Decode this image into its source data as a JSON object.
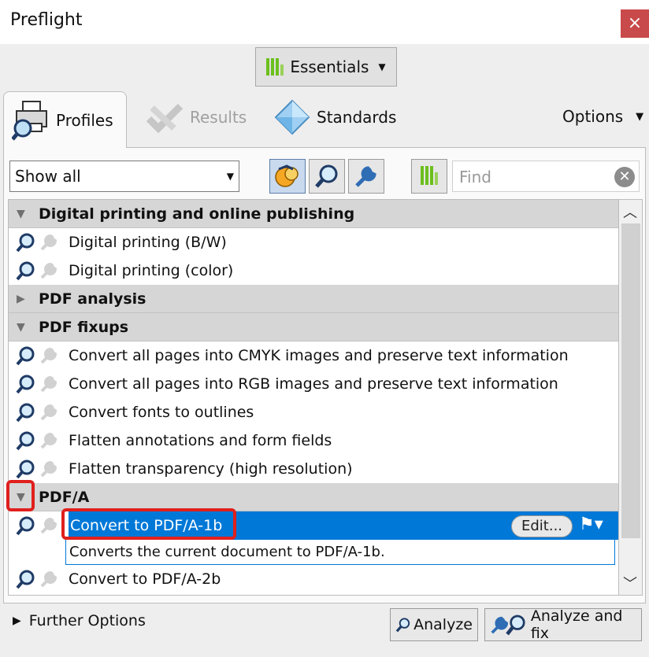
{
  "window": {
    "title": "Preflight",
    "close": "×"
  },
  "toolbar": {
    "essentials_label": "Essentials"
  },
  "tabs": {
    "profiles": "Profiles",
    "results": "Results",
    "standards": "Standards",
    "options": "Options"
  },
  "filter": {
    "selected": "Show all",
    "find_placeholder": "Find"
  },
  "groups": [
    {
      "name": "Digital printing and online publishing",
      "expanded": true,
      "items": [
        "Digital printing (B/W)",
        "Digital printing (color)"
      ]
    },
    {
      "name": "PDF analysis",
      "expanded": false,
      "items": []
    },
    {
      "name": "PDF fixups",
      "expanded": true,
      "items": [
        "Convert all pages into CMYK images and preserve text information",
        "Convert all pages into RGB images and preserve text information",
        "Convert fonts to outlines",
        "Flatten annotations and form fields",
        "Flatten transparency (high resolution)"
      ]
    },
    {
      "name": "PDF/A",
      "expanded": true,
      "items": [
        "Convert to PDF/A-1b",
        "Convert to PDF/A-2b"
      ]
    }
  ],
  "selected_item": {
    "label": "Convert to PDF/A-1b",
    "description": "Converts the current document to PDF/A-1b.",
    "edit_label": "Edit..."
  },
  "footer": {
    "further_options": "Further Options",
    "analyze": "Analyze",
    "analyze_fix": "Analyze and fix"
  },
  "colors": {
    "selection": "#0078d7",
    "highlight": "#e0201d",
    "accent_green": "#6cbf1d"
  }
}
